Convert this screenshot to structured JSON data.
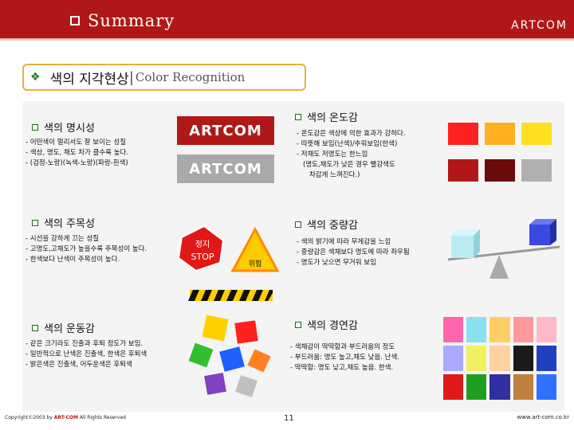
{
  "header": {
    "title": "Summary",
    "brand": "ARTCOM"
  },
  "main_title": {
    "ko": "색의 지각현상",
    "separator": "|",
    "en": "Color Recognition"
  },
  "sections": {
    "visibility": {
      "title": "색의 명시성",
      "lines": [
        "- 어떤색이 멀리서도 잘 보이는 성질",
        "- 색상, 명도, 채도 차가 클수록 높다.",
        "- (검정-노랑)(녹색-노랑)(파랑-흰색)"
      ]
    },
    "temperature": {
      "title": "색의 온도감",
      "lines": [
        "- 온도감은 색상에 의한 효과가 강하다.",
        "- 따뜻해 보임(난색)/추워보임(한색)",
        "- 저채도 저명도는 한느낌",
        "  (명도,채도가 낮은 경우 빨강색도",
        "   차갑게 느껴진다.)"
      ]
    },
    "attention": {
      "title": "색의 주목성",
      "lines": [
        "- 시선을 강하게 끄는 성질",
        "- 고명도,고채도가 높을수록 주목성이 높다.",
        "- 한색보다 난색이 주목성이 높다."
      ]
    },
    "weight": {
      "title": "색의 중량감",
      "lines": [
        "- 색의 밝기에 따라 무게감을 느낌",
        "- 중량감은 색채보다 명도에 따라 좌우됨",
        "- 명도가 낮으면 무거워 보임"
      ]
    },
    "motion": {
      "title": "색의 운동감",
      "lines": [
        "- 같은 크기라도 진출과 후퇴 정도가 보임.",
        "- 일반적으로 난색은 진출색, 한색은 후퇴색",
        "- 밝은색은 진출색, 어두운색은 후퇴색"
      ]
    },
    "hardness": {
      "title": "색의 경연감",
      "lines": [
        "- 색채감이 딱딱함과 부드러움의 정도",
        "- 부드러움: 명도 높고,채도 낮음. 난색.",
        "- 딱딱함: 명도 낮고,채도 높음. 한색."
      ]
    }
  },
  "artcom_samples": {
    "red": "ARTCOM",
    "gray": "ARTCOM"
  },
  "signs": {
    "stop_line1": "정지",
    "stop_line2": "STOP",
    "caution": "위험"
  },
  "colors": {
    "header_red": "#b01818",
    "temperature_swatches": [
      "#ff2020",
      "#ffb020",
      "#ffe020",
      "#b01818",
      "#6a0a0a",
      "#b0b0b0"
    ],
    "hardness_swatches": [
      "#ff66aa",
      "#88e0f0",
      "#ffcc66",
      "#ff9999",
      "#ffb8c8",
      "#aaaaff",
      "#f0f060",
      "#ffd0a0",
      "#1a1a1a",
      "#2040c0",
      "#e01818",
      "#20a020",
      "#3030a0",
      "#c08040",
      "#3070ff"
    ],
    "motion_squares": [
      "#ffd000",
      "#ff2020",
      "#30c030",
      "#2060ff",
      "#ff8020",
      "#8040c0",
      "#c0c0c0"
    ]
  },
  "footer": {
    "copyright_prefix": "Copyright©2003 by ",
    "copyright_brand": "ART-COM",
    "copyright_suffix": " All Rights Reserved",
    "page": "11",
    "url": "www.art-com.co.kr"
  }
}
